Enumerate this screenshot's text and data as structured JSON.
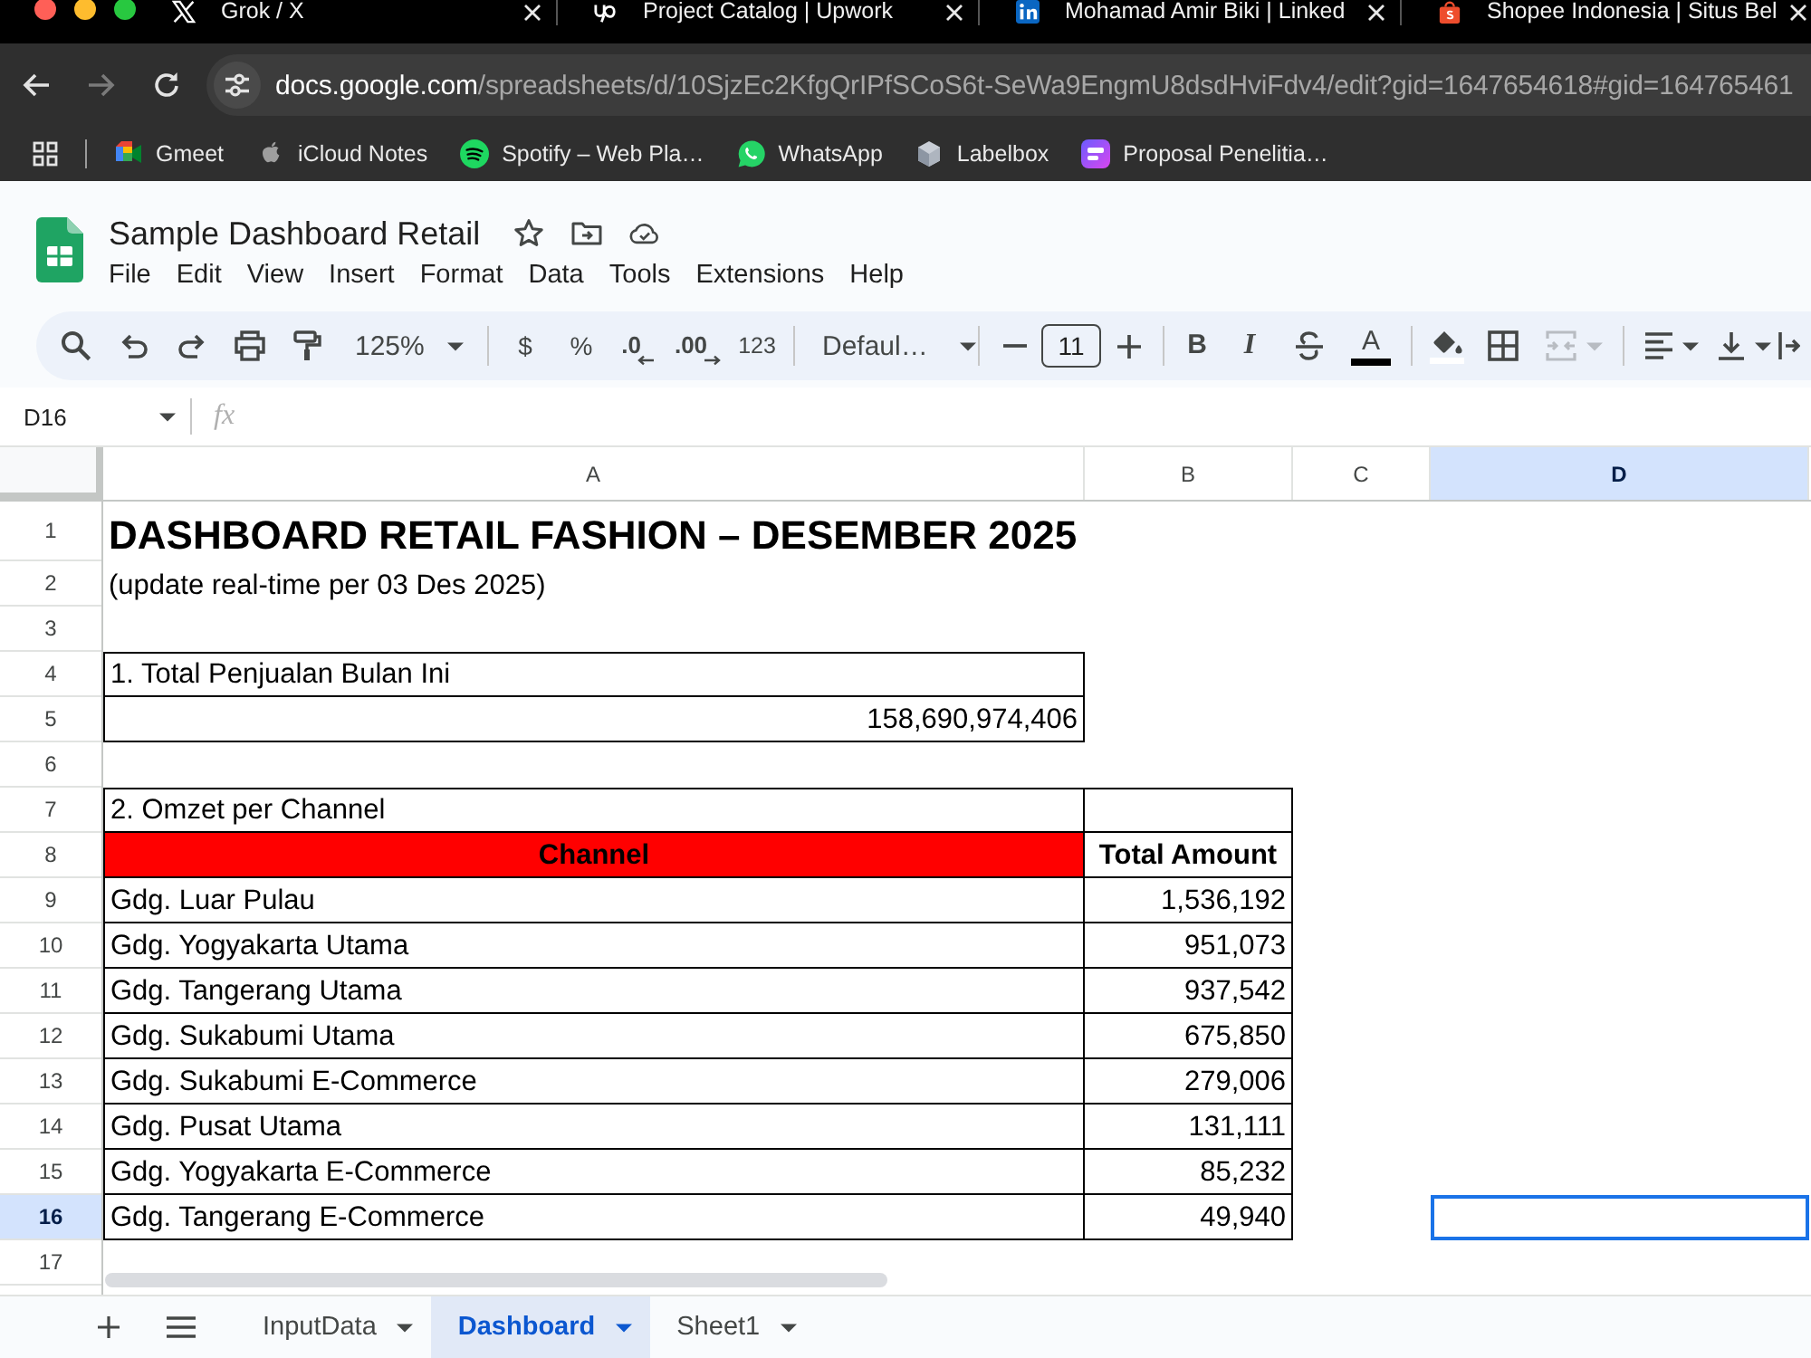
{
  "browser": {
    "tabs": [
      {
        "title": "Grok / X"
      },
      {
        "title": "Project Catalog | Upwork"
      },
      {
        "title": "Mohamad Amir Biki | Linked"
      },
      {
        "title": "Shopee Indonesia | Situs Bel"
      }
    ],
    "forward": {
      "disabled": true
    },
    "address": {
      "host": "docs.google.com",
      "path": "/spreadsheets/d/10SjzEc2KfgQrIPfSCoS6t-SeWa9EngmU8dsdHviFdv4/edit?gid=1647654618#gid=164765461"
    },
    "bookmarks": [
      {
        "label": "Gmeet"
      },
      {
        "label": "iCloud Notes"
      },
      {
        "label": "Spotify – Web Pla…"
      },
      {
        "label": "WhatsApp"
      },
      {
        "label": "Labelbox"
      },
      {
        "label": "Proposal Penelitia…"
      }
    ]
  },
  "document": {
    "title": "Sample Dashboard Retail",
    "menu": [
      "File",
      "Edit",
      "View",
      "Insert",
      "Format",
      "Data",
      "Tools",
      "Extensions",
      "Help"
    ]
  },
  "toolbar": {
    "zoom": "125%",
    "currency": "$",
    "percent": "%",
    "decrease_decimals": ".0",
    "increase_decimals": ".00",
    "number_format": "123",
    "font": "Defaul…",
    "font_size": "11",
    "bold": "B",
    "italic": "I",
    "text_color": "A",
    "merge": {
      "disabled": true
    }
  },
  "formula_bar": {
    "cell_ref": "D16",
    "function_label": "fx"
  },
  "sheet": {
    "columns": [
      {
        "label": "A",
        "selected": false
      },
      {
        "label": "B",
        "selected": false
      },
      {
        "label": "C",
        "selected": false
      },
      {
        "label": "D",
        "selected": true
      }
    ],
    "rows": [
      {
        "number": "1",
        "selected": false
      },
      {
        "number": "2",
        "selected": false
      },
      {
        "number": "3",
        "selected": false
      },
      {
        "number": "4",
        "selected": false
      },
      {
        "number": "5",
        "selected": false
      },
      {
        "number": "6",
        "selected": false
      },
      {
        "number": "7",
        "selected": false
      },
      {
        "number": "8",
        "selected": false
      },
      {
        "number": "9",
        "selected": false
      },
      {
        "number": "10",
        "selected": false
      },
      {
        "number": "11",
        "selected": false
      },
      {
        "number": "12",
        "selected": false
      },
      {
        "number": "13",
        "selected": false
      },
      {
        "number": "14",
        "selected": false
      },
      {
        "number": "15",
        "selected": false
      },
      {
        "number": "16",
        "selected": true
      },
      {
        "number": "17",
        "selected": false
      }
    ],
    "title": "DASHBOARD RETAIL FASHION – DESEMBER 2025",
    "subtitle": "(update real-time per 03 Des 2025)",
    "total_sales": {
      "label": "1. Total Penjualan Bulan Ini",
      "value": "158,690,974,406"
    },
    "channel_table": {
      "label": "2. Omzet per Channel",
      "headers": [
        "Channel",
        "Total Amount"
      ],
      "rows": [
        {
          "channel": "Gdg. Luar Pulau",
          "amount": "1,536,192"
        },
        {
          "channel": "Gdg. Yogyakarta Utama",
          "amount": "951,073"
        },
        {
          "channel": "Gdg. Tangerang Utama",
          "amount": "937,542"
        },
        {
          "channel": "Gdg. Sukabumi Utama",
          "amount": "675,850"
        },
        {
          "channel": "Gdg. Sukabumi E-Commerce",
          "amount": "279,006"
        },
        {
          "channel": "Gdg. Pusat Utama",
          "amount": "131,111"
        },
        {
          "channel": "Gdg. Yogyakarta E-Commerce",
          "amount": "85,232"
        },
        {
          "channel": "Gdg. Tangerang E-Commerce",
          "amount": "49,940"
        }
      ]
    }
  },
  "sheet_tabs": [
    {
      "name": "InputData",
      "selected": false
    },
    {
      "name": "Dashboard",
      "selected": true
    },
    {
      "name": "Sheet1",
      "selected": false
    }
  ]
}
